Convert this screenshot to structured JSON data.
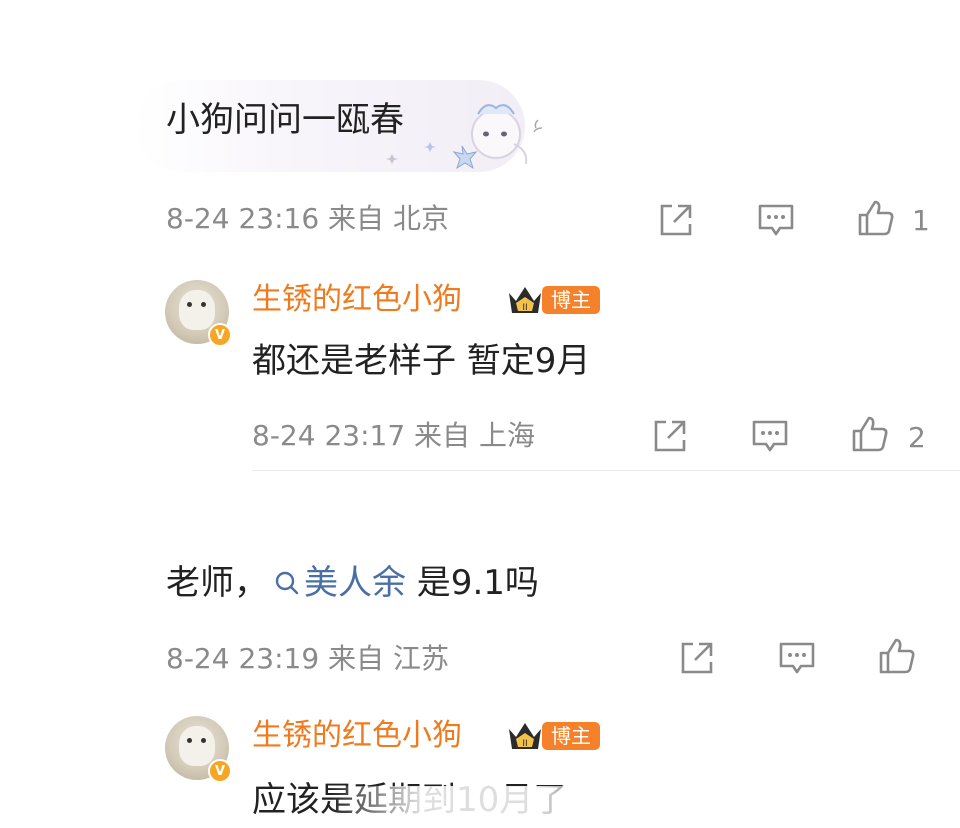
{
  "comments": [
    {
      "text": "小狗问问一瓯春",
      "meta": "8-24 23:16  来自 北京",
      "like_count": "1",
      "reply": {
        "username": "生锈的红色小狗",
        "badge": "博主",
        "text": "都还是老样子 暂定9月",
        "meta": "8-24 23:17  来自 上海",
        "like_count": "2"
      }
    },
    {
      "text_prefix": "老师，",
      "topic": "美人余",
      "text_suffix": " 是9.1吗",
      "meta": "8-24 23:19  来自 江苏",
      "like_count": "",
      "reply": {
        "username": "生锈的红色小狗",
        "badge": "博主",
        "text": "应该是延期到10月了",
        "meta": "",
        "like_count": ""
      }
    }
  ],
  "icons": {
    "share": "share-icon",
    "comment": "comment-icon",
    "like": "thumbs-up-icon",
    "search": "search-icon",
    "crown": "crown-icon",
    "verified": "verified-icon"
  },
  "colors": {
    "username": "#f07a1c",
    "badge": "#f5822a",
    "topic": "#4a6fa5",
    "meta": "#8a8a8a"
  },
  "verified_mark": "V"
}
